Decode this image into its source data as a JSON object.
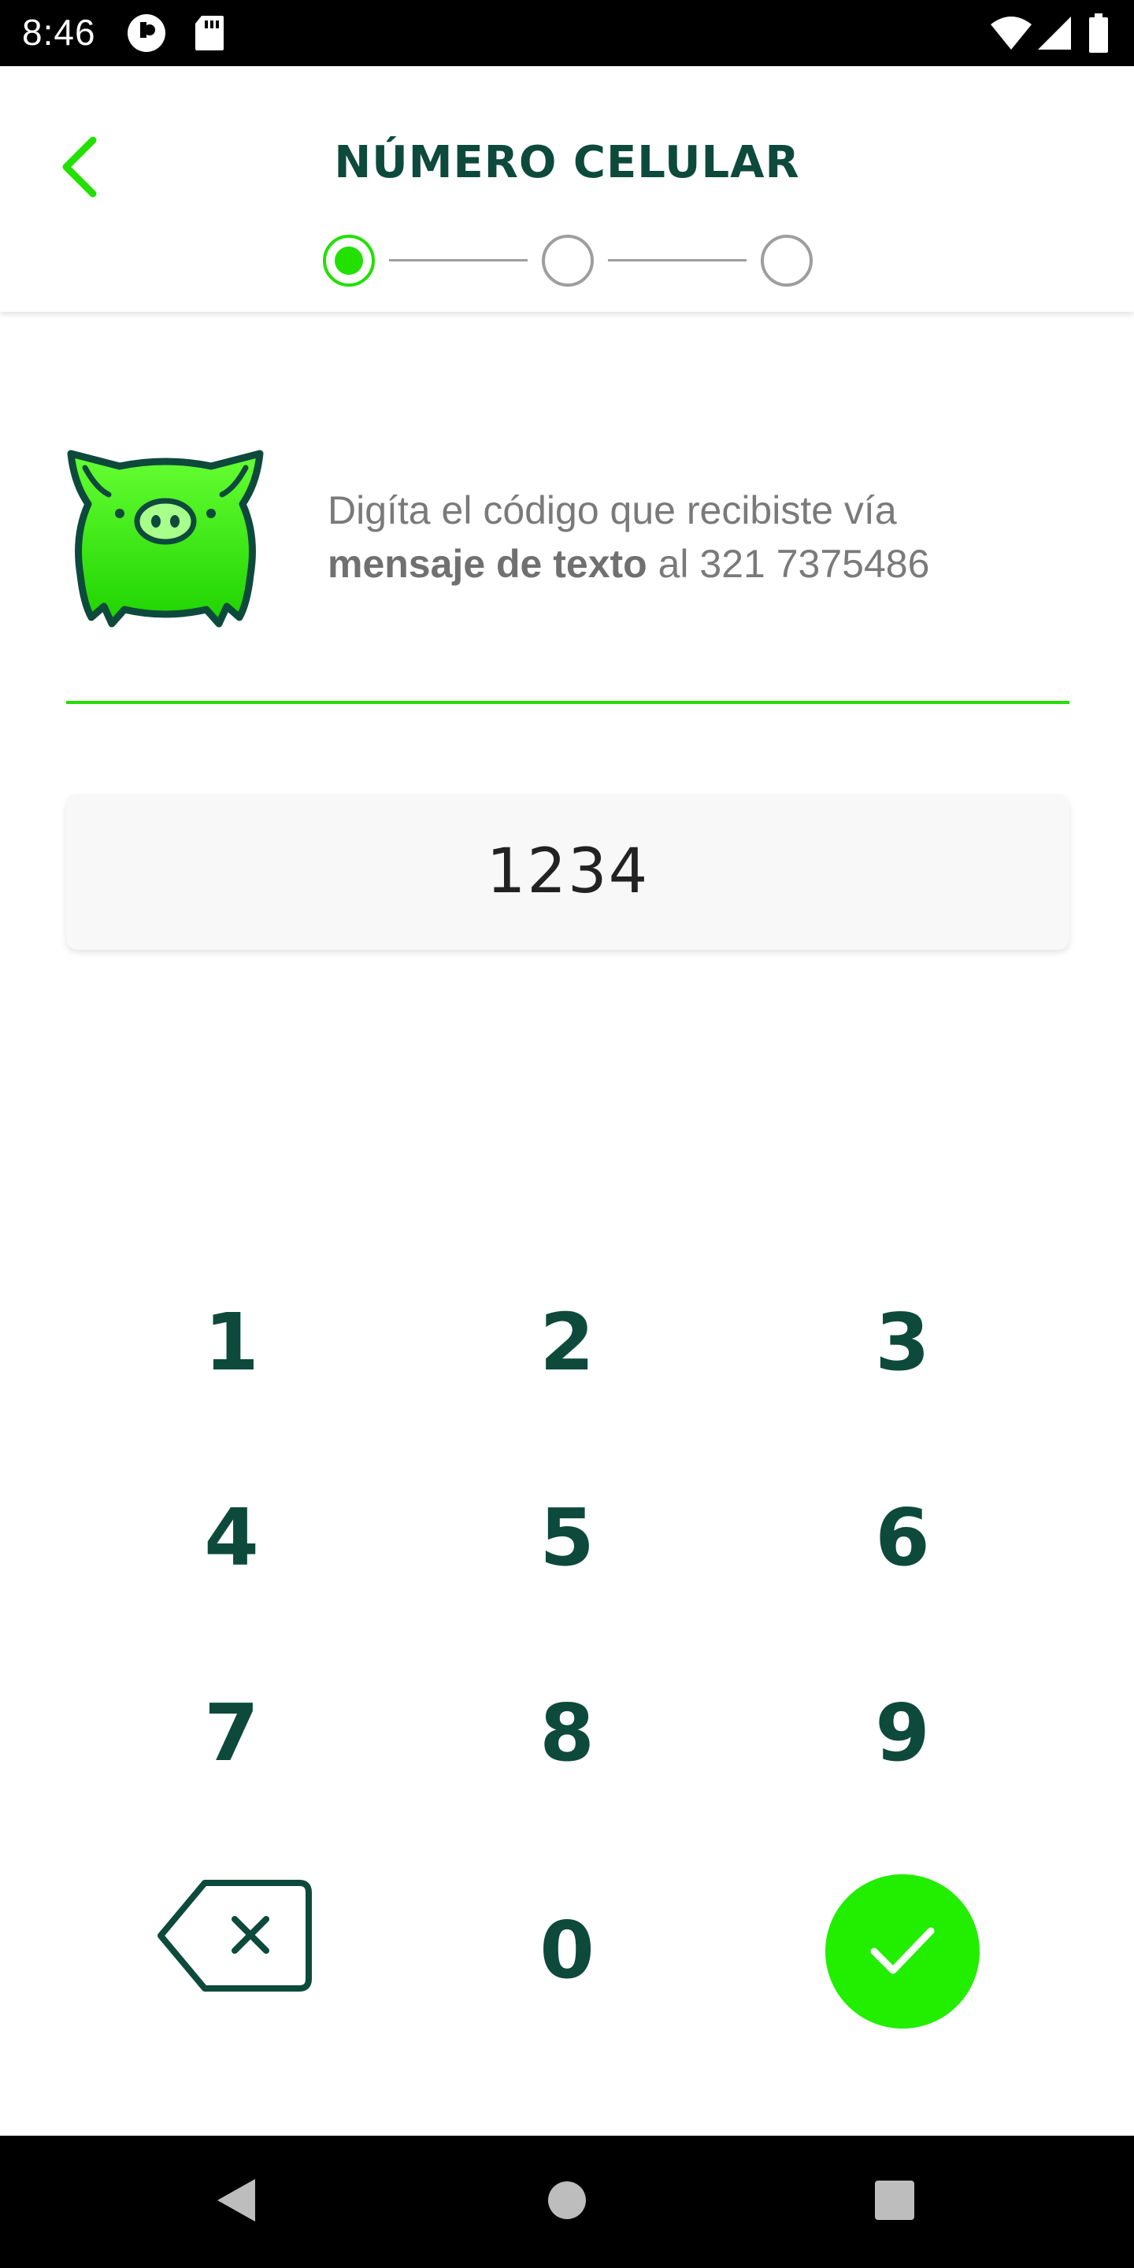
{
  "status_bar": {
    "time": "8:46",
    "left_icons": [
      "notification-app-icon",
      "sd-card-icon"
    ],
    "right_icons": [
      "wifi-icon",
      "cell-signal-icon",
      "battery-icon"
    ]
  },
  "header": {
    "title": "NÚMERO CELULAR",
    "back_icon": "chevron-left-icon",
    "steps": [
      {
        "state": "active"
      },
      {
        "state": "inactive"
      },
      {
        "state": "inactive"
      }
    ]
  },
  "info": {
    "icon": "pig-logo-icon",
    "line1": "Digíta el código que recibiste vía",
    "line2_bold": "mensaje de texto",
    "line2_rest": " al 321 7375486"
  },
  "code_input": {
    "value": "1234"
  },
  "keypad": {
    "keys": [
      "1",
      "2",
      "3",
      "4",
      "5",
      "6",
      "7",
      "8",
      "9",
      "0"
    ],
    "delete_icon": "backspace-icon",
    "confirm_icon": "check-icon"
  },
  "nav_bar": {
    "icons": [
      "back-triangle-icon",
      "home-circle-icon",
      "recents-square-icon"
    ]
  },
  "colors": {
    "brand_green": "#22e000",
    "dark_green": "#0d4a3c",
    "text_gray": "#7a7a7a"
  }
}
